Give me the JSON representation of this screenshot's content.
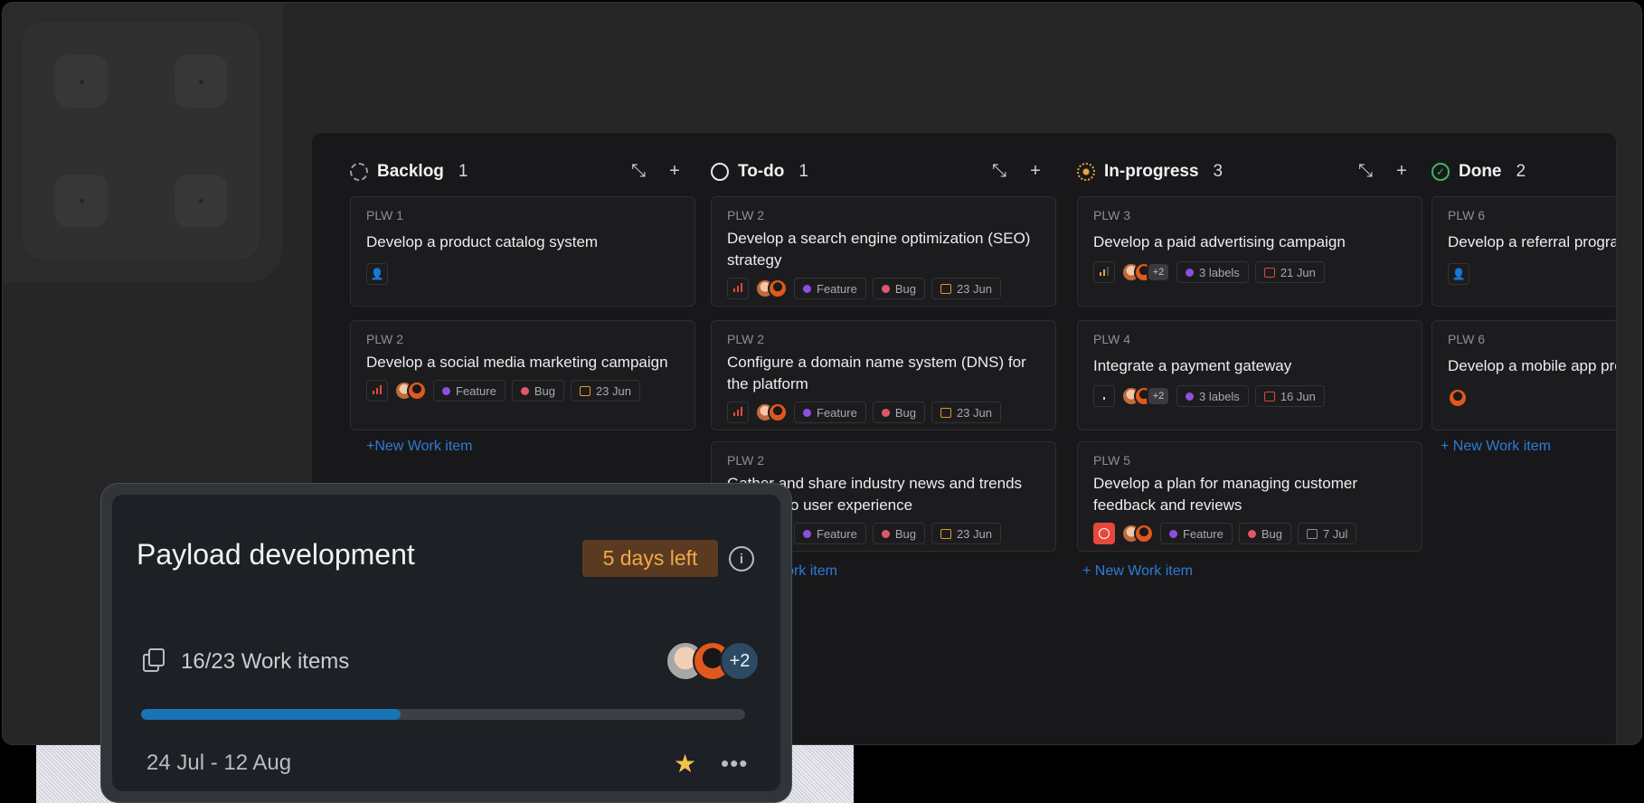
{
  "board": {
    "columns": [
      {
        "title": "Backlog",
        "count": "1",
        "status": "backlog",
        "cards": [
          {
            "id": "PLW 1",
            "title": "Develop a product catalog system",
            "layout": "empty"
          },
          {
            "id": "PLW 2",
            "title": "Develop a social media marketing campaign",
            "labels": [
              "Feature",
              "Bug"
            ],
            "date": "23 Jun"
          }
        ],
        "new_item": "New Work item"
      },
      {
        "title": "To-do",
        "count": "1",
        "status": "todo",
        "cards": [
          {
            "id": "PLW 2",
            "title": "Develop a search engine optimization (SEO) strategy",
            "labels": [
              "Feature",
              "Bug"
            ],
            "date": "23 Jun"
          },
          {
            "id": "PLW 2",
            "title": "Configure a domain name system (DNS) for the platform",
            "labels": [
              "Feature",
              "Bug"
            ],
            "date": "23 Jun"
          },
          {
            "id": "PLW 2",
            "title": "Gather and share industry news and trends relevant to user experience",
            "labels": [
              "Feature",
              "Bug"
            ],
            "date": "23 Jun"
          }
        ],
        "new_item": "New Work item"
      },
      {
        "title": "In-progress",
        "count": "3",
        "status": "in-progress",
        "cards": [
          {
            "id": "PLW 3",
            "title": "Develop a paid advertising campaign",
            "more": "+2",
            "labels_text": "3 labels",
            "date": "21 Jun"
          },
          {
            "id": "PLW 4",
            "title": "Integrate a payment gateway",
            "more": "+2",
            "labels_text": "3 labels",
            "date": "16 Jun"
          },
          {
            "id": "PLW 5",
            "title": "Develop a plan for managing customer feedback and reviews",
            "labels": [
              "Feature",
              "Bug"
            ],
            "date": "7 Jul"
          }
        ],
        "new_item": "New Work item"
      },
      {
        "title": "Done",
        "count": "2",
        "status": "done",
        "cards": [
          {
            "id": "PLW 6",
            "title": "Develop a referral program"
          },
          {
            "id": "PLW 6",
            "title": "Develop a mobile app presence"
          }
        ],
        "new_item": "New Work item"
      }
    ],
    "colors": {
      "feature": "#8e4fe0",
      "bug": "#e2566b",
      "urgent": "#e5483c",
      "link": "#2f7bd6"
    }
  },
  "cycle": {
    "title": "Payload development",
    "badge": "5 days left",
    "info_icon": "info-icon",
    "items_label": "16/23 Work items",
    "progress": 0.43,
    "avatars_more": "+2",
    "dates": "24 Jul - 12 Aug",
    "star_icon": "star-icon",
    "more_icon": "more-icon"
  }
}
